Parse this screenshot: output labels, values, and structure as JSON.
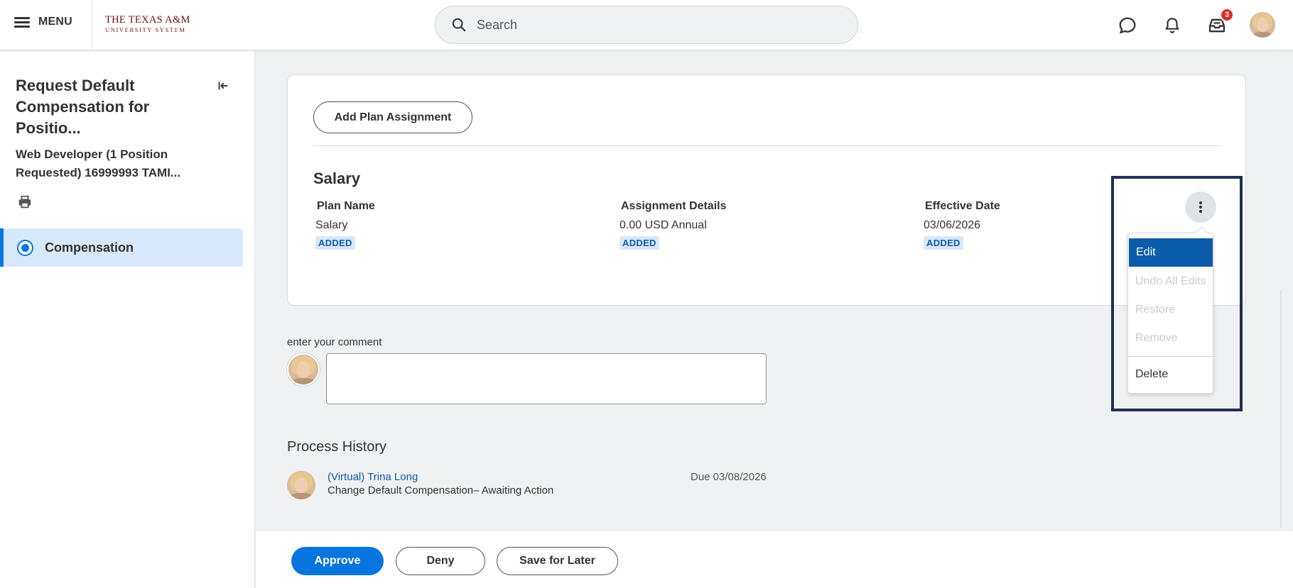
{
  "header": {
    "menu_label": "MENU",
    "logo_line1": "THE TEXAS A&M",
    "logo_line2": "UNIVERSITY SYSTEM",
    "search_placeholder": "Search",
    "inbox_badge": "3"
  },
  "sidebar": {
    "title": "Request Default Compensation for Positio...",
    "subtitle": "Web Developer (1 Position Requested) 16999993 TAMI...",
    "nav": [
      {
        "label": "Compensation",
        "selected": true
      }
    ]
  },
  "card": {
    "add_plan_button": "Add Plan Assignment",
    "section_title": "Salary",
    "columns": [
      {
        "header": "Plan Name",
        "value": "Salary",
        "tag": "ADDED"
      },
      {
        "header": "Assignment Details",
        "value": "0.00 USD Annual",
        "tag": "ADDED"
      },
      {
        "header": "Effective Date",
        "value": "03/06/2026",
        "tag": "ADDED"
      }
    ]
  },
  "action_menu": {
    "items": [
      {
        "label": "Edit",
        "state": "active"
      },
      {
        "label": "Undo All Edits",
        "state": "disabled"
      },
      {
        "label": "Restore",
        "state": "disabled"
      },
      {
        "label": "Remove",
        "state": "disabled"
      },
      {
        "label": "Delete",
        "state": "enabled"
      }
    ]
  },
  "comment": {
    "label": "enter your comment",
    "value": ""
  },
  "process_history": {
    "title": "Process History",
    "entries": [
      {
        "name": "(Virtual) Trina Long",
        "description": "Change Default Compensation– Awaiting Action",
        "due": "Due 03/08/2026"
      }
    ]
  },
  "footer": {
    "approve": "Approve",
    "deny": "Deny",
    "save_for_later": "Save for Later"
  },
  "colors": {
    "primary": "#0875e1",
    "active_menu": "#0b5cab",
    "badge": "#de2e21",
    "logo": "#6b0f1a",
    "highlight_border": "#1d2f54",
    "tag_bg": "#d8e8fb"
  }
}
